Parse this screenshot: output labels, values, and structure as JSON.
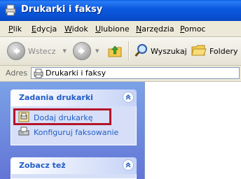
{
  "window": {
    "title": "Drukarki i faksy"
  },
  "menu": {
    "items": [
      {
        "label": "Plik",
        "key": "P",
        "rest": "lik"
      },
      {
        "label": "Edycja",
        "key": "E",
        "rest": "dycja"
      },
      {
        "label": "Widok",
        "key": "W",
        "rest": "idok"
      },
      {
        "label": "Ulubione",
        "key": "U",
        "rest": "lubione"
      },
      {
        "label": "Narzędzia",
        "key": "N",
        "rest": "arzędzia"
      },
      {
        "label": "Pomoc",
        "key": "P",
        "rest": "omoc"
      }
    ]
  },
  "toolbar": {
    "back_label": "Wstecz",
    "search_label": "Wyszukaj",
    "folders_label": "Foldery"
  },
  "address": {
    "label": "Adres",
    "value": "Drukarki i faksy"
  },
  "tasks_panel": {
    "title": "Zadania drukarki",
    "items": [
      {
        "label": "Dodaj drukarkę",
        "icon": "add-printer-icon"
      },
      {
        "label": "Konfiguruj faksowanie",
        "icon": "fax-icon"
      }
    ]
  },
  "see_also_panel": {
    "title": "Zobacz też"
  },
  "colors": {
    "titlebar": "#0a52d6",
    "link": "#215dc6",
    "highlight": "#b4142a"
  }
}
